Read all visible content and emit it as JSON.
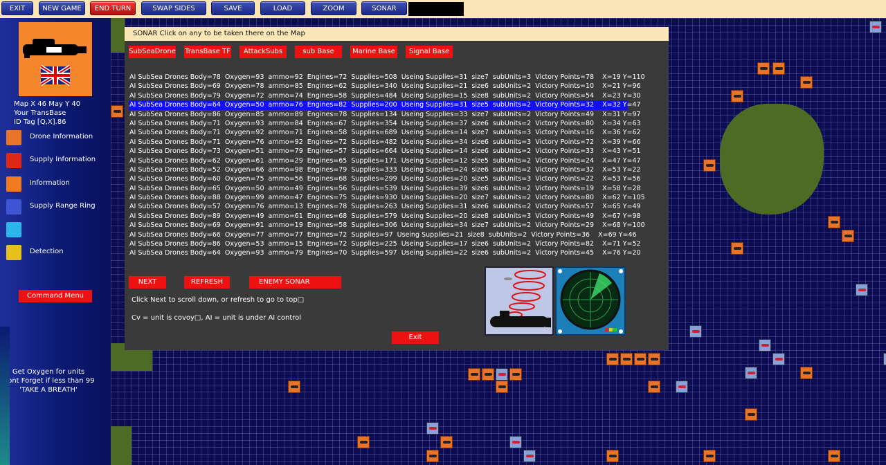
{
  "toolbar": {
    "buttons": [
      "EXIT",
      "NEW GAME",
      "END TURN",
      "SWAP SIDES",
      "SAVE",
      "LOAD",
      "ZOOM",
      "SONAR"
    ]
  },
  "sidebar": {
    "map_coords": "Map X 46  May Y 40",
    "base_name": "Your TransBase",
    "id_tag": "ID Tag [Q,X].86",
    "items": [
      {
        "label": "Drone Information",
        "icon": "drone-icon",
        "color": "#e8742a"
      },
      {
        "label": "Supply Information",
        "icon": "supply-barrel-icon",
        "color": "#e02818"
      },
      {
        "label": "Information",
        "icon": "info-cross-icon",
        "color": "#f07a1e"
      },
      {
        "label": "Supply Range Ring",
        "icon": "range-ring-icon",
        "color": "#3f55d6"
      },
      {
        "label": "",
        "icon": "cyan-tile-icon",
        "color": "#2ab6e8"
      },
      {
        "label": "Detection",
        "icon": "detection-icon",
        "color": "#e7c01c"
      }
    ],
    "command_menu": "Command Menu",
    "footer": [
      "Get Oxygen for units",
      "Dont Forget if less than 99",
      "'TAKE A BREATH'"
    ]
  },
  "dialog": {
    "header": "SONAR Click on any to be taken there on the Map",
    "filters": [
      "SubSeaDrone",
      "TransBase TF",
      "AttackSubs",
      "sub Base",
      "Marine Base",
      "Signal Base"
    ],
    "selected_row": 3,
    "rows": [
      "AI SubSea Drones Body=78  Oxygen=93  ammo=92  Engines=72  Supplies=508  Useing Supplies=31  size7  subUnits=3  Victory Points=78    X=19 Y=110",
      "AI SubSea Drones Body=69  Oxygen=78  ammo=85  Engines=62  Supplies=340  Useing Supplies=21  size6  subUnits=2  Victory Points=10    X=21 Y=96",
      "AI SubSea Drones Body=79  Oxygen=72  ammo=74  Engines=58  Supplies=484  Useing Supplies=15  size8  subUnits=2  Victory Points=54    X=23 Y=30",
      "AI SubSea Drones Body=64  Oxygen=50  ammo=76  Engines=82  Supplies=200  Useing Supplies=31  size5  subUnits=2  Victory Points=32    X=32 Y=47",
      "AI SubSea Drones Body=86  Oxygen=85  ammo=89  Engines=78  Supplies=134  Useing Supplies=33  size7  subUnits=2  Victory Points=49    X=31 Y=97",
      "AI SubSea Drones Body=71  Oxygen=93  ammo=84  Engines=67  Supplies=354  Useing Supplies=37  size6  subUnits=2  Victory Points=80    X=34 Y=63",
      "AI SubSea Drones Body=71  Oxygen=92  ammo=71  Engines=58  Supplies=689  Useing Supplies=14  size7  subUnits=3  Victory Points=16    X=36 Y=62",
      "AI SubSea Drones Body=71  Oxygen=76  ammo=92  Engines=72  Supplies=482  Useing Supplies=34  size6  subUnits=3  Victory Points=72    X=39 Y=66",
      "AI SubSea Drones Body=73  Oxygen=51  ammo=79  Engines=57  Supplies=664  Useing Supplies=14  size6  subUnits=2  Victory Points=33    X=43 Y=51",
      "AI SubSea Drones Body=62  Oxygen=61  ammo=29  Engines=65  Supplies=171  Useing Supplies=12  size5  subUnits=2  Victory Points=24    X=47 Y=47",
      "AI SubSea Drones Body=52  Oxygen=66  ammo=98  Engines=79  Supplies=333  Useing Supplies=24  size6  subUnits=2  Victory Points=32    X=53 Y=22",
      "AI SubSea Drones Body=60  Oxygen=75  ammo=56  Engines=68  Supplies=299  Useing Supplies=20  size5  subUnits=3  Victory Points=22    X=53 Y=56",
      "AI SubSea Drones Body=65  Oxygen=50  ammo=49  Engines=56  Supplies=539  Useing Supplies=39  size6  subUnits=2  Victory Points=19    X=58 Y=28",
      "AI SubSea Drones Body=88  Oxygen=99  ammo=47  Engines=75  Supplies=930  Useing Supplies=20  size7  subUnits=2  Victory Points=80    X=62 Y=105",
      "AI SubSea Drones Body=57  Oxygen=76  ammo=13  Engines=78  Supplies=263  Useing Supplies=31  size6  subUnits=2  Victory Points=57    X=65 Y=49",
      "AI SubSea Drones Body=89  Oxygen=49  ammo=61  Engines=68  Supplies=579  Useing Supplies=20  size8  subUnits=3  Victory Points=49    X=67 Y=98",
      "AI SubSea Drones Body=69  Oxygen=91  ammo=19  Engines=58  Supplies=306  Useing Supplies=34  size7  subUnits=2  Victory Points=29    X=68 Y=100",
      "AI SubSea Drones Body=66  Oxygen=77  ammo=77  Engines=72  Supplies=97  Useing Supplies=21  size8  subUnits=2  Victory Points=36    X=69 Y=46",
      "AI SubSea Drones Body=86  Oxygen=53  ammo=15  Engines=72  Supplies=225  Useing Supplies=17  size6  subUnits=2  Victory Points=82    X=71 Y=52",
      "AI SubSea Drones Body=64  Oxygen=93  ammo=79  Engines=70  Supplies=597  Useing Supplies=22  size6  subUnits=2  Victory Points=45    X=76 Y=20"
    ],
    "next": "NEXT",
    "refresh": "REFRESH",
    "enemy_sonar": "ENEMY SONAR",
    "note1": "Click Next to scroll down, or refresh to go to top□",
    "note2": "Cv = unit is covoy□, AI = unit is under AI control",
    "exit": "Exit"
  }
}
